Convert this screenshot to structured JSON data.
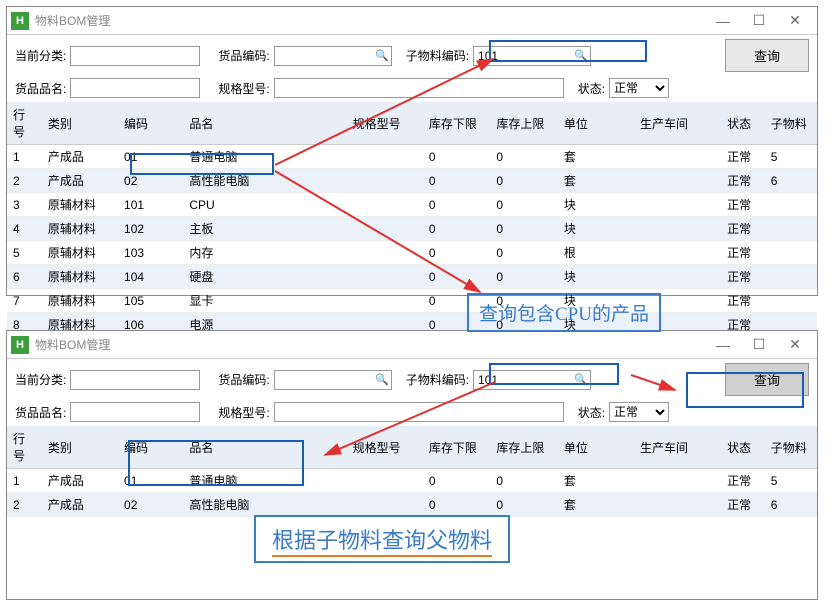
{
  "window_title": "物料BOM管理",
  "labels": {
    "current_category": "当前分类:",
    "product_code": "货品编码:",
    "sub_material_code": "子物料编码:",
    "product_name": "货品品名:",
    "spec_model": "规格型号:",
    "status": "状态:",
    "query": "查询"
  },
  "status_options": {
    "normal": "正常"
  },
  "top": {
    "sub_material_value": "101",
    "columns": [
      "行号",
      "类别",
      "编码",
      "品名",
      "规格型号",
      "库存下限",
      "库存上限",
      "单位",
      "生产车间",
      "状态",
      "子物料"
    ],
    "rows": [
      {
        "no": "1",
        "cat": "产成品",
        "code": "01",
        "name": "普通电脑",
        "spec": "",
        "min": "0",
        "max": "0",
        "unit": "套",
        "ws": "",
        "st": "正常",
        "sub": "5"
      },
      {
        "no": "2",
        "cat": "产成品",
        "code": "02",
        "name": "高性能电脑",
        "spec": "",
        "min": "0",
        "max": "0",
        "unit": "套",
        "ws": "",
        "st": "正常",
        "sub": "6"
      },
      {
        "no": "3",
        "cat": "原辅材料",
        "code": "101",
        "name": "CPU",
        "spec": "",
        "min": "0",
        "max": "0",
        "unit": "块",
        "ws": "",
        "st": "正常",
        "sub": ""
      },
      {
        "no": "4",
        "cat": "原辅材料",
        "code": "102",
        "name": "主板",
        "spec": "",
        "min": "0",
        "max": "0",
        "unit": "块",
        "ws": "",
        "st": "正常",
        "sub": ""
      },
      {
        "no": "5",
        "cat": "原辅材料",
        "code": "103",
        "name": "内存",
        "spec": "",
        "min": "0",
        "max": "0",
        "unit": "根",
        "ws": "",
        "st": "正常",
        "sub": ""
      },
      {
        "no": "6",
        "cat": "原辅材料",
        "code": "104",
        "name": "硬盘",
        "spec": "",
        "min": "0",
        "max": "0",
        "unit": "块",
        "ws": "",
        "st": "正常",
        "sub": ""
      },
      {
        "no": "7",
        "cat": "原辅材料",
        "code": "105",
        "name": "显卡",
        "spec": "",
        "min": "0",
        "max": "0",
        "unit": "块",
        "ws": "",
        "st": "正常",
        "sub": ""
      },
      {
        "no": "8",
        "cat": "原辅材料",
        "code": "106",
        "name": "电源",
        "spec": "",
        "min": "0",
        "max": "0",
        "unit": "块",
        "ws": "",
        "st": "正常",
        "sub": ""
      }
    ]
  },
  "bottom": {
    "sub_material_value": "101",
    "columns": [
      "行号",
      "类别",
      "编码",
      "品名",
      "规格型号",
      "库存下限",
      "库存上限",
      "单位",
      "生产车间",
      "状态",
      "子物料"
    ],
    "rows": [
      {
        "no": "1",
        "cat": "产成品",
        "code": "01",
        "name": "普通电脑",
        "spec": "",
        "min": "0",
        "max": "0",
        "unit": "套",
        "ws": "",
        "st": "正常",
        "sub": "5"
      },
      {
        "no": "2",
        "cat": "产成品",
        "code": "02",
        "name": "高性能电脑",
        "spec": "",
        "min": "0",
        "max": "0",
        "unit": "套",
        "ws": "",
        "st": "正常",
        "sub": "6"
      }
    ]
  },
  "annotations": {
    "box1": "查询包含CPU的产品",
    "box2": "根据子物料查询父物料"
  }
}
